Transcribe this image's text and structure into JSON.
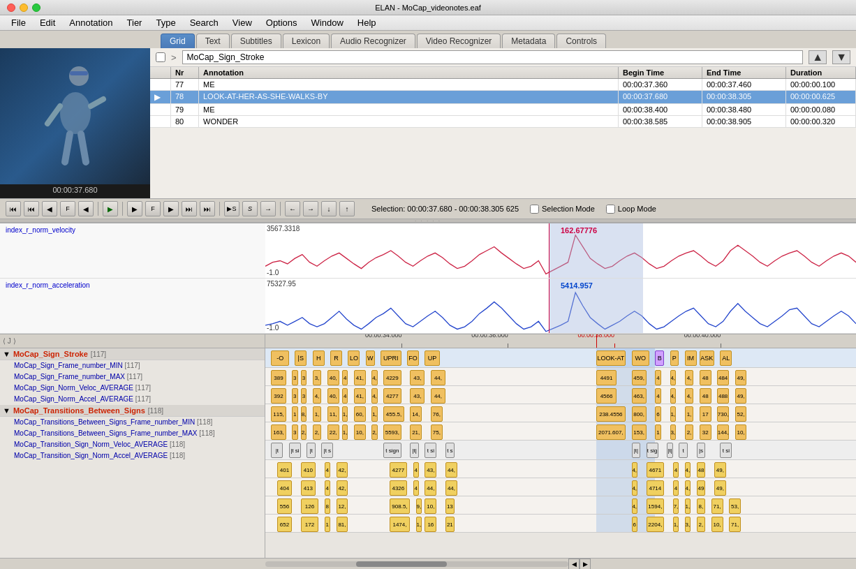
{
  "window": {
    "title": "ELAN - MoCap_videonotes.eaf"
  },
  "menubar": {
    "items": [
      "File",
      "Edit",
      "Annotation",
      "Tier",
      "Type",
      "Search",
      "View",
      "Options",
      "Window",
      "Help"
    ]
  },
  "tabs": [
    {
      "label": "Grid",
      "active": true
    },
    {
      "label": "Text",
      "active": false
    },
    {
      "label": "Subtitles",
      "active": false
    },
    {
      "label": "Lexicon",
      "active": false
    },
    {
      "label": "Audio Recognizer",
      "active": false
    },
    {
      "label": "Video Recognizer",
      "active": false
    },
    {
      "label": "Metadata",
      "active": false
    },
    {
      "label": "Controls",
      "active": false
    }
  ],
  "tier_selector": {
    "name": "MoCap_Sign_Stroke"
  },
  "annotation_table": {
    "headers": [
      "",
      "Nr",
      "Annotation",
      "Begin Time",
      "End Time",
      "Duration"
    ],
    "rows": [
      {
        "nr": "77",
        "annotation": "ME",
        "begin": "00:00:37.360",
        "end": "00:00:37.460",
        "duration": "00:00:00.100",
        "selected": false,
        "playing": false
      },
      {
        "nr": "78",
        "annotation": "LOOK-AT-HER-AS-SHE-WALKS-BY",
        "begin": "00:00:37.680",
        "end": "00:00:38.305",
        "duration": "00:00:00.625",
        "selected": true,
        "playing": true
      },
      {
        "nr": "79",
        "annotation": "ME",
        "begin": "00:00:38.400",
        "end": "00:00:38.480",
        "duration": "00:00:00.080",
        "selected": false,
        "playing": false
      },
      {
        "nr": "80",
        "annotation": "WONDER",
        "begin": "00:00:38.585",
        "end": "00:00:38.905",
        "duration": "00:00:00.320",
        "selected": false,
        "playing": false
      }
    ]
  },
  "video": {
    "timestamp": "00:00:37.680"
  },
  "selection_info": "Selection: 00:00:37.680 - 00:00:38.305  625",
  "transport": {
    "buttons": [
      "⏮",
      "⏮",
      "◀",
      "F",
      "◀",
      "▶",
      "▶",
      "F",
      "⏭",
      "⏭"
    ],
    "play_label": "▶",
    "selection_mode": "Selection Mode",
    "loop_mode": "Loop Mode"
  },
  "charts": {
    "top": {
      "label": "index_r_norm_velocity",
      "max_value": "3567.3318",
      "min_value": "-1.0",
      "cursor_value": "162.67776",
      "highlight_value": "162.67776"
    },
    "bottom": {
      "label": "index_r_norm_acceleration",
      "max_value": "75327.95",
      "min_value": "-1.0",
      "cursor_value": "5414.957",
      "highlight_value": "5414.957"
    }
  },
  "timeline": {
    "ruler_marks": [
      {
        "time": "00:00:34.000",
        "pos_pct": 20
      },
      {
        "time": "00:00:36.000",
        "pos_pct": 38
      },
      {
        "time": "00:00:38.000",
        "pos_pct": 55
      },
      {
        "time": "00:00:40.000",
        "pos_pct": 72
      }
    ],
    "tier_groups": [
      {
        "name": "MoCap_Sign_Stroke",
        "count": "[117]",
        "color": "red",
        "subtiers": []
      },
      {
        "name": "MoCap_Sign_Frame_number_MIN",
        "count": "[117]",
        "color": "blue",
        "subtiers": []
      },
      {
        "name": "MoCap_Sign_Frame_number_MAX",
        "count": "[117]",
        "color": "blue",
        "subtiers": []
      },
      {
        "name": "MoCap_Sign_Norm_Veloc_AVERAGE",
        "count": "[117]",
        "color": "blue",
        "subtiers": []
      },
      {
        "name": "MoCap_Sign_Norm_Accel_AVERAGE",
        "count": "[117]",
        "color": "blue",
        "subtiers": []
      },
      {
        "name": "MoCap_Transitions_Between_Signs",
        "count": "[118]",
        "color": "red",
        "subtiers": []
      },
      {
        "name": "MoCap_Transitions_Between_Signs_Frame_number_MIN",
        "count": "[118]",
        "color": "blue",
        "subtiers": []
      },
      {
        "name": "MoCap_Transitions_Between_Signs_Frame_number_MAX",
        "count": "[118]",
        "color": "blue",
        "subtiers": []
      },
      {
        "name": "MoCap_Transition_Sign_Norm_Veloc_AVERAGE",
        "count": "[118]",
        "color": "blue",
        "subtiers": []
      },
      {
        "name": "MoCap_Transition_Sign_Norm_Accel_AVERAGE",
        "count": "[118]",
        "color": "blue",
        "subtiers": []
      }
    ]
  }
}
